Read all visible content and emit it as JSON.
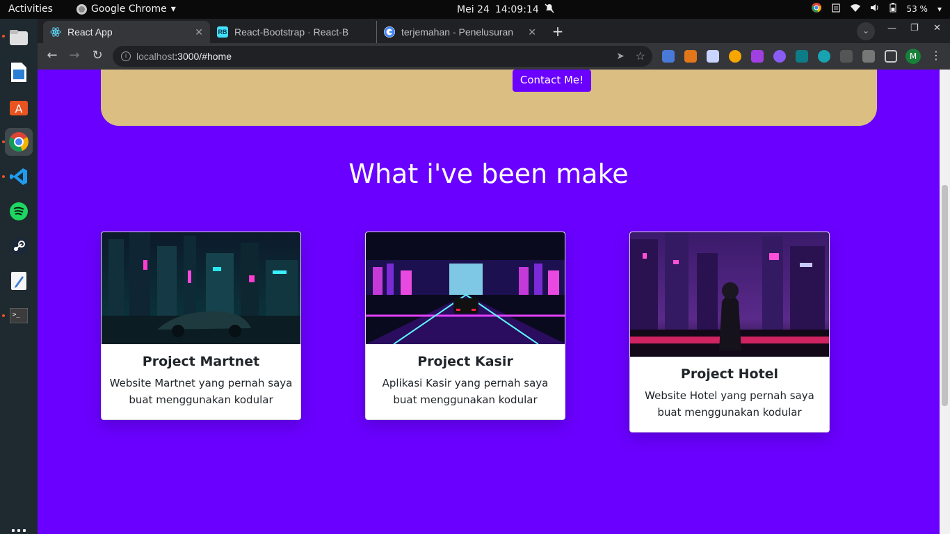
{
  "system": {
    "activities": "Activities",
    "app_name": "Google Chrome",
    "date": "Mei 24",
    "time": "14:09:14",
    "battery": "53 %"
  },
  "browser": {
    "tabs": [
      {
        "title": "React App",
        "active": true
      },
      {
        "title": "React-Bootstrap · React-B",
        "active": false
      },
      {
        "title": "terjemahan - Penelusuran",
        "active": false
      }
    ],
    "url_host": "localhost",
    "url_rest": ":3000/#home",
    "profile_initial": "M"
  },
  "page": {
    "contact_button": "Contact Me!",
    "section_title": "What i've been make",
    "projects": [
      {
        "title": "Project Martnet",
        "description": "Website Martnet yang pernah saya buat menggunakan kodular"
      },
      {
        "title": "Project Kasir",
        "description": "Aplikasi Kasir yang pernah saya buat menggunakan kodular"
      },
      {
        "title": "Project Hotel",
        "description": "Website Hotel yang pernah saya buat menggunakan kodular"
      }
    ]
  },
  "colors": {
    "page_background": "#6a00ff",
    "contact_panel": "#dbbe82",
    "button": "#6a00ff"
  }
}
